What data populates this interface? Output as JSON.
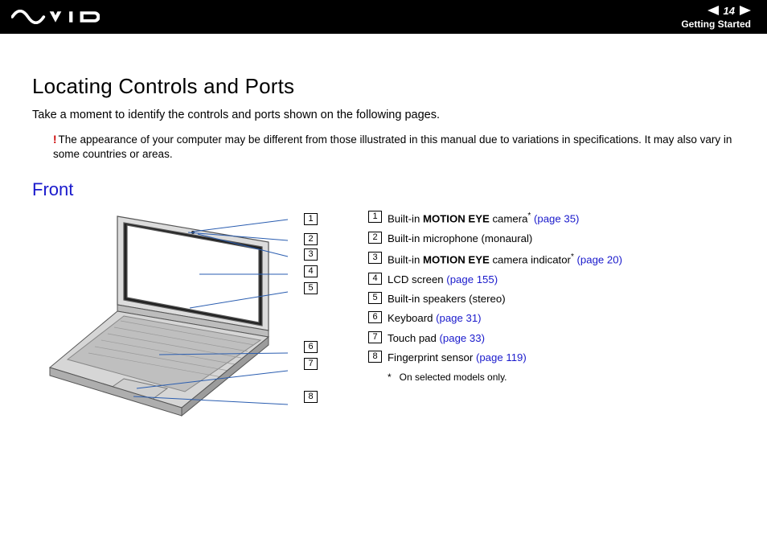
{
  "header": {
    "page_number": "14",
    "section": "Getting Started"
  },
  "title": "Locating Controls and Ports",
  "intro": "Take a moment to identify the controls and ports shown on the following pages.",
  "warning_mark": "!",
  "warning": "The appearance of your computer may be different from those illustrated in this manual due to variations in specifications. It may also vary in some countries or areas.",
  "subheading": "Front",
  "callout_numbers": [
    "1",
    "2",
    "3",
    "4",
    "5",
    "6",
    "7",
    "8"
  ],
  "legend": {
    "1": {
      "pre": "Built-in ",
      "bold": "MOTION EYE",
      "post": " camera",
      "star": "*",
      "link": "(page 35)"
    },
    "2": {
      "text": "Built-in microphone (monaural)"
    },
    "3": {
      "pre": "Built-in ",
      "bold": "MOTION EYE",
      "post": " camera indicator",
      "star": "*",
      "link": "(page 20)"
    },
    "4": {
      "text": "LCD screen ",
      "link": "(page 155)"
    },
    "5": {
      "text": "Built-in speakers (stereo)"
    },
    "6": {
      "text": "Keyboard ",
      "link": "(page 31)"
    },
    "7": {
      "text": "Touch pad ",
      "link": "(page 33)"
    },
    "8": {
      "text": "Fingerprint sensor ",
      "link": "(page 119)"
    }
  },
  "footnote": {
    "mark": "*",
    "text": "On selected models only."
  }
}
